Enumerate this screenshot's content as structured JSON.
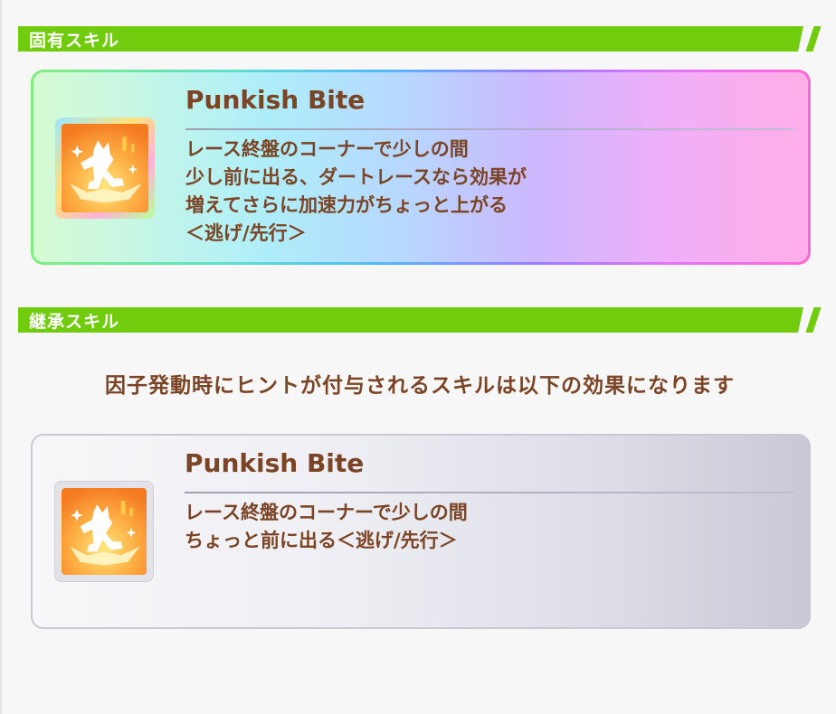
{
  "unique_section": {
    "title": "固有スキル",
    "skill": {
      "name": "Punkish Bite",
      "description_lines": [
        "レース終盤のコーナーで少しの間",
        "少し前に出る、ダートレースなら効果が",
        "増えてさらに加速力がちょっと上がる",
        "＜逃げ/先行＞"
      ],
      "icon": "running-horse-speed-icon"
    }
  },
  "inherit_section": {
    "title": "継承スキル",
    "hint": "因子発動時にヒントが付与されるスキルは以下の効果になります",
    "skill": {
      "name": "Punkish Bite",
      "description_lines": [
        "レース終盤のコーナーで少しの間",
        "ちょっと前に出る＜逃げ/先行＞"
      ],
      "icon": "running-horse-speed-icon"
    }
  },
  "colors": {
    "section_bar": "#72cc0e",
    "text_brown": "#7a4425"
  }
}
